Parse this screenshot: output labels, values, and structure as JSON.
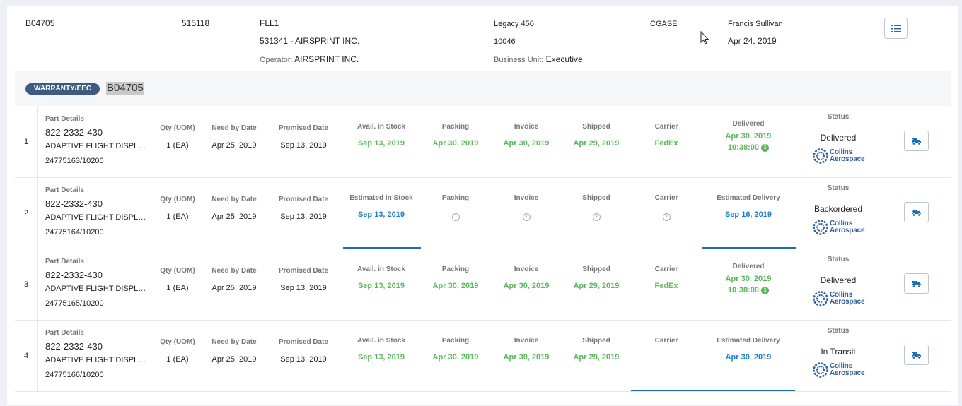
{
  "header": {
    "order_id": "B04705",
    "account_no": "515118",
    "location": "FLL1",
    "customer": "531341 - AIRSPRINT INC.",
    "operator_label": "Operator:",
    "operator_value": "AIRSPRINT INC.",
    "aircraft_model": "Legacy 450",
    "serial": "10046",
    "bu_label": "Business Unit:",
    "bu_value": "Executive",
    "code": "CGASE",
    "user": "Francis Sullivan",
    "date": "Apr 24, 2019",
    "menu_icon": "list-icon"
  },
  "order": {
    "badge": "WARRANTY/EEC",
    "id": "B04705"
  },
  "labels": {
    "part_details": "Part Details",
    "qty": "Qty (UOM)",
    "need_by": "Need by Date",
    "promised": "Promised Date",
    "packing": "Packing",
    "invoice": "Invoice",
    "shipped": "Shipped",
    "carrier": "Carrier",
    "status": "Status"
  },
  "vendor": {
    "line1": "Collins",
    "line2": "Aerospace"
  },
  "colors": {
    "green": "#5cb85c",
    "blue": "#1f7fd1",
    "badge": "#3d5a80"
  },
  "rows": [
    {
      "num": "1",
      "part_no": "822-2332-430",
      "desc": "ADAPTIVE FLIGHT DISPLAY",
      "po": "24775163/10200",
      "qty": "1 (EA)",
      "need_by": "Apr 25, 2019",
      "promised": "Sep 13, 2019",
      "stock_label": "Avail. in Stock",
      "stock": "Sep 13, 2019",
      "packing": "Apr 30, 2019",
      "invoice": "Apr 30, 2019",
      "shipped": "Apr 29, 2019",
      "carrier": "FedEx",
      "delivery_label": "Delivered",
      "delivery": "Apr 30, 2019",
      "delivery_time": "10:38:00",
      "status": "Delivered"
    },
    {
      "num": "2",
      "part_no": "822-2332-430",
      "desc": "ADAPTIVE FLIGHT DISPLAY",
      "po": "24775164/10200",
      "qty": "1 (EA)",
      "need_by": "Apr 25, 2019",
      "promised": "Sep 13, 2019",
      "stock_label": "Estimated in Stock",
      "stock": "Sep 13, 2019",
      "packing": "",
      "invoice": "",
      "shipped": "",
      "carrier": "",
      "delivery_label": "Estimated Delivery",
      "delivery": "Sep 16, 2019",
      "delivery_time": "",
      "status": "Backordered"
    },
    {
      "num": "3",
      "part_no": "822-2332-430",
      "desc": "ADAPTIVE FLIGHT DISPLAY",
      "po": "24775165/10200",
      "qty": "1 (EA)",
      "need_by": "Apr 25, 2019",
      "promised": "Sep 13, 2019",
      "stock_label": "Avail. in Stock",
      "stock": "Sep 13, 2019",
      "packing": "Apr 30, 2019",
      "invoice": "Apr 30, 2019",
      "shipped": "Apr 29, 2019",
      "carrier": "FedEx",
      "delivery_label": "Delivered",
      "delivery": "Apr 30, 2019",
      "delivery_time": "10:38:00",
      "status": "Delivered"
    },
    {
      "num": "4",
      "part_no": "822-2332-430",
      "desc": "ADAPTIVE FLIGHT DISPLAY",
      "po": "24775166/10200",
      "qty": "1 (EA)",
      "need_by": "Apr 25, 2019",
      "promised": "Sep 13, 2019",
      "stock_label": "Avail. in Stock",
      "stock": "Sep 13, 2019",
      "packing": "Apr 30, 2019",
      "invoice": "Apr 30, 2019",
      "shipped": "Apr 29, 2019",
      "carrier": "",
      "delivery_label": "Estimated Delivery",
      "delivery": "Apr 30, 2019",
      "delivery_time": "",
      "status": "In Transit"
    }
  ]
}
